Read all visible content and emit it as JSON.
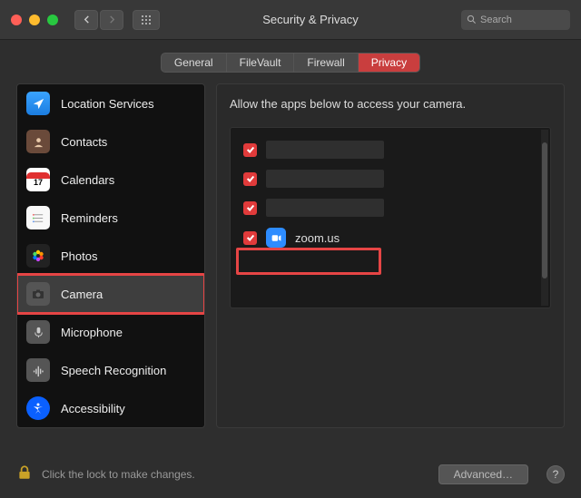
{
  "window": {
    "title": "Security & Privacy"
  },
  "search": {
    "placeholder": "Search"
  },
  "tabs": {
    "items": [
      {
        "label": "General",
        "active": false
      },
      {
        "label": "FileVault",
        "active": false
      },
      {
        "label": "Firewall",
        "active": false
      },
      {
        "label": "Privacy",
        "active": true
      }
    ]
  },
  "sidebar": {
    "items": [
      {
        "label": "Location Services",
        "icon": "location"
      },
      {
        "label": "Contacts",
        "icon": "contacts"
      },
      {
        "label": "Calendars",
        "icon": "calendar"
      },
      {
        "label": "Reminders",
        "icon": "reminders"
      },
      {
        "label": "Photos",
        "icon": "photos"
      },
      {
        "label": "Camera",
        "icon": "camera",
        "selected": true,
        "highlighted": true
      },
      {
        "label": "Microphone",
        "icon": "mic"
      },
      {
        "label": "Speech Recognition",
        "icon": "speech"
      },
      {
        "label": "Accessibility",
        "icon": "accessibility"
      }
    ],
    "calendar_day": "17"
  },
  "detail": {
    "heading": "Allow the apps below to access your camera.",
    "apps": [
      {
        "checked": true,
        "name_redacted": true
      },
      {
        "checked": true,
        "name_redacted": true
      },
      {
        "checked": true,
        "name_redacted": true
      },
      {
        "checked": true,
        "name": "zoom.us",
        "icon": "zoom",
        "highlighted": true
      }
    ]
  },
  "footer": {
    "lock_text": "Click the lock to make changes.",
    "advanced_label": "Advanced…",
    "help_label": "?"
  }
}
